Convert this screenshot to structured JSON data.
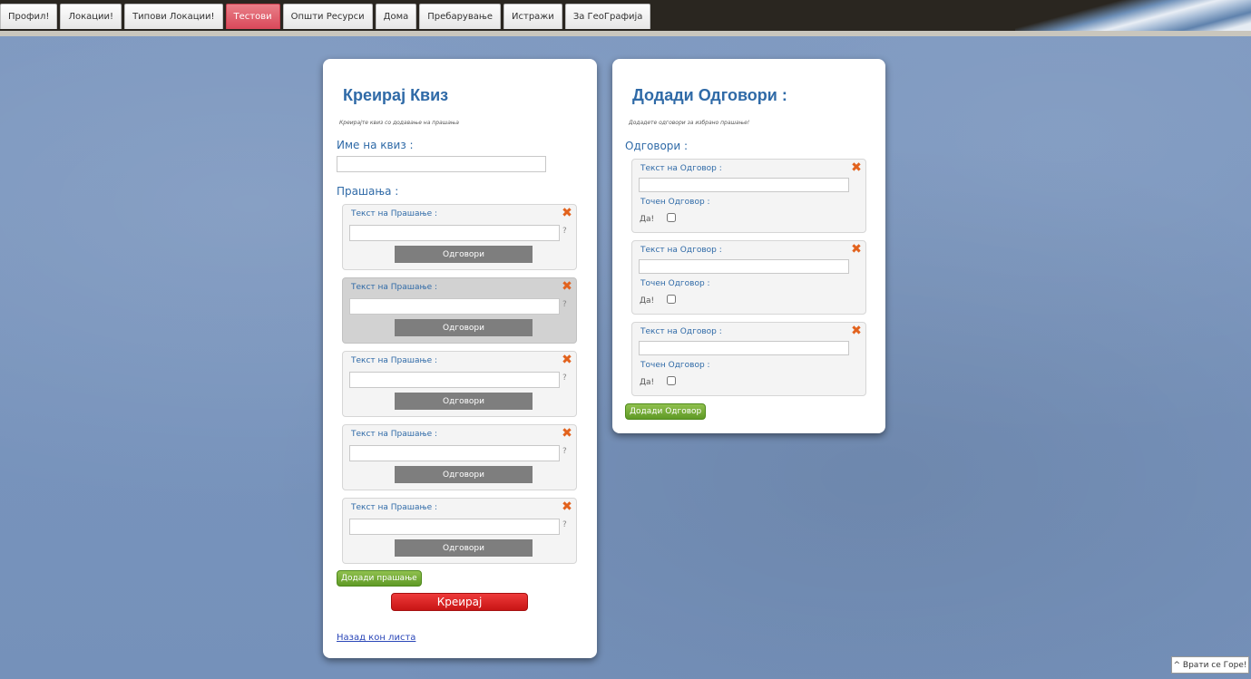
{
  "nav": {
    "tabs": [
      {
        "label": "Профил!"
      },
      {
        "label": "Локации!"
      },
      {
        "label": "Типови Локации!"
      },
      {
        "label": "Тестови"
      },
      {
        "label": "Општи Ресурси"
      },
      {
        "label": "Дома"
      },
      {
        "label": "Пребарување"
      },
      {
        "label": "Истражи"
      },
      {
        "label": "За ГеоГрафија"
      }
    ],
    "active_tab": "Тестови"
  },
  "quiz": {
    "title": "Креирај Квиз",
    "subtitle": "Креирајте квиз со додавање на прашања",
    "name_label": "Име на квиз :",
    "name_value": "",
    "questions_label": "Прашања :",
    "question_label": "Текст на Прашање :",
    "question_mark": "?",
    "answers_button": "Одговори",
    "questions": [
      {
        "value": ""
      },
      {
        "value": ""
      },
      {
        "value": ""
      },
      {
        "value": ""
      },
      {
        "value": ""
      }
    ],
    "add_question_button": "Додади прашање",
    "create_button": "Креирај",
    "back_link": "Назад кон листа"
  },
  "answers": {
    "title": "Додади Одговори :",
    "subtitle": "Додадете одговори за избрано прашање!",
    "answers_label": "Одговори :",
    "answer_label": "Текст на Одговор :",
    "correct_label": "Точен Одговор :",
    "yes_label": "Да!",
    "items": [
      {
        "value": "",
        "correct": false
      },
      {
        "value": "",
        "correct": false
      },
      {
        "value": "",
        "correct": false
      }
    ],
    "add_answer_button": "Додади Одговор"
  },
  "back_to_top": "^ Врати се Горе!",
  "colors": {
    "accent_blue": "#2f6aa7",
    "active_tab": "#d9485a",
    "delete_icon": "#e2621d",
    "green_button": "#6aa52f",
    "red_button": "#d81e1e"
  }
}
